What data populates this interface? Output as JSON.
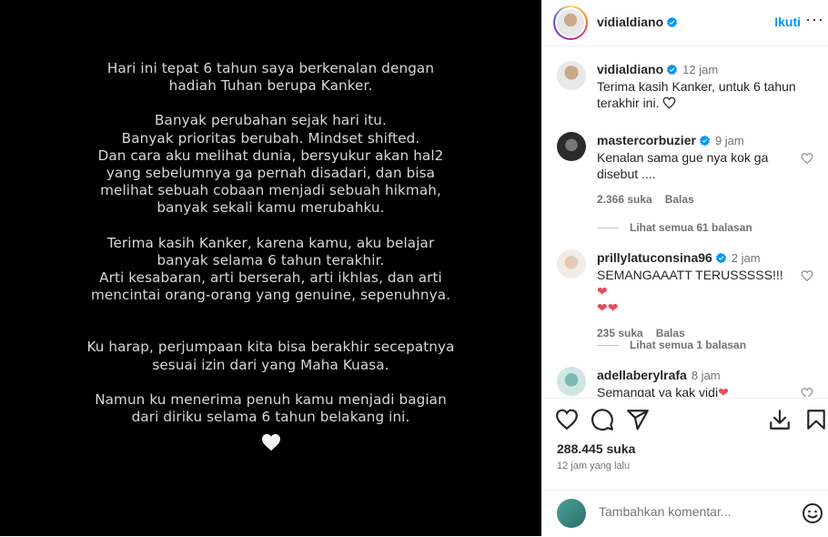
{
  "post": {
    "paragraphs": [
      [
        "Hari ini tepat 6 tahun saya berkenalan dengan",
        "hadiah Tuhan berupa Kanker."
      ],
      [
        "Banyak perubahan sejak hari itu.",
        "Banyak prioritas berubah. Mindset shifted.",
        "Dan cara aku melihat dunia, bersyukur akan hal2",
        "yang sebelumnya ga pernah disadari, dan bisa",
        "melihat sebuah cobaan menjadi sebuah hikmah,",
        "banyak sekali kamu merubahku."
      ],
      [
        "Terima kasih Kanker, karena kamu, aku belajar",
        "banyak selama 6 tahun terakhir.",
        "Arti kesabaran, arti berserah, arti ikhlas, dan arti",
        "mencintai orang-orang yang genuine, sepenuhnya."
      ],
      [
        "Ku harap, perjumpaan kita bisa berakhir secepatnya",
        "sesuai izin dari yang Maha Kuasa."
      ],
      [
        "Namun ku menerima penuh kamu menjadi bagian",
        "dari diriku selama 6 tahun belakang ini."
      ]
    ]
  },
  "header": {
    "username": "vidialdiano",
    "follow_label": "Ikuti",
    "more_label": "···"
  },
  "caption": {
    "username": "vidialdiano",
    "time": "12 jam",
    "text": "Terima kasih Kanker, untuk 6 tahun terakhir ini."
  },
  "comments": [
    {
      "username": "mastercorbuzier",
      "time": "9 jam",
      "text": "Kenalan sama gue nya kok ga disebut ....",
      "likes": "2.366 suka",
      "reply_label": "Balas",
      "view_replies": "Lihat semua 61 balasan"
    },
    {
      "username": "prillylatuconsina96",
      "time": "2 jam",
      "text": "SEMANGAAATT TERUSSSSS!!!",
      "likes": "235 suka",
      "reply_label": "Balas",
      "view_replies": "Lihat semua 1 balasan"
    },
    {
      "username": "adellaberylrafa",
      "time": "8 jam",
      "text": "Semangat ya kak vidi"
    }
  ],
  "stats": {
    "likes": "288.445 suka",
    "posted": "12 jam yang lalu"
  },
  "add_comment": {
    "placeholder": "Tambahkan komentar..."
  },
  "colors": {
    "accent": "#0095f6",
    "heart_red": "#ed4956",
    "post_bg": "#000000"
  }
}
